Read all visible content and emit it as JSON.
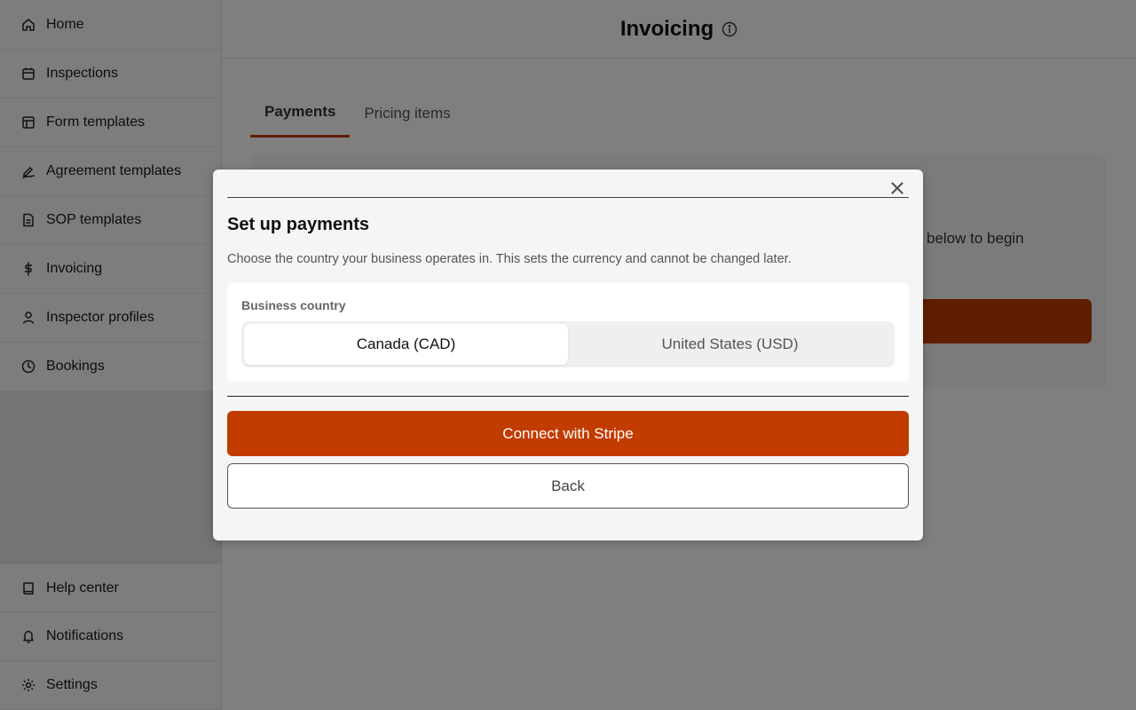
{
  "sidebar": {
    "items": [
      {
        "label": "Home",
        "icon": "home-icon"
      },
      {
        "label": "Inspections",
        "icon": "calendar-icon"
      },
      {
        "label": "Form templates",
        "icon": "layout-icon"
      },
      {
        "label": "Agreement templates",
        "icon": "signature-icon"
      },
      {
        "label": "SOP templates",
        "icon": "document-icon"
      },
      {
        "label": "Invoicing",
        "icon": "dollar-icon"
      },
      {
        "label": "Inspector profiles",
        "icon": "user-icon"
      },
      {
        "label": "Bookings",
        "icon": "clock-icon"
      }
    ],
    "bottom_items": [
      {
        "label": "Help center",
        "icon": "book-icon"
      },
      {
        "label": "Notifications",
        "icon": "bell-icon"
      },
      {
        "label": "Settings",
        "icon": "gear-icon"
      }
    ]
  },
  "header": {
    "title": "Invoicing",
    "info_icon": "info-icon"
  },
  "tabs": [
    {
      "label": "Payments",
      "active": true
    },
    {
      "label": "Pricing items",
      "active": false
    }
  ],
  "card": {
    "partial_text": "below to begin"
  },
  "modal": {
    "title": "Set up payments",
    "description": "Choose the country your business operates in. This sets the currency and cannot be changed later.",
    "country_label": "Business country",
    "options": [
      "Canada (CAD)",
      "United States (USD)"
    ],
    "selected_option": "Canada (CAD)",
    "primary_button": "Connect with Stripe",
    "secondary_button": "Back",
    "close_icon": "close-icon"
  },
  "colors": {
    "accent": "#c23b00",
    "overlay": "rgba(0,0,0,0.5)"
  }
}
